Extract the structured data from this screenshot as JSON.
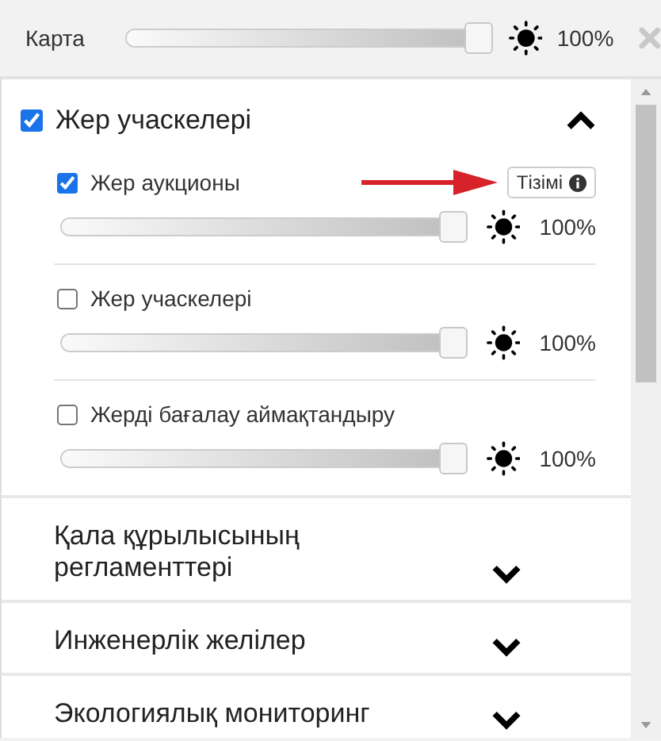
{
  "header": {
    "label": "Карта",
    "level": 1,
    "reading": "100%"
  },
  "groups": [
    {
      "title": "Жер учаскелері",
      "checked": true,
      "expanded": true,
      "layers": [
        {
          "name": "Жер аукционы",
          "checked": true,
          "list_button": "Тізімі",
          "level": 1,
          "reading": "100%"
        },
        {
          "name": "Жер учаскелері",
          "checked": false,
          "level": 1,
          "reading": "100%"
        },
        {
          "name": "Жерді бағалау аймақтандыру",
          "checked": false,
          "level": 1,
          "reading": "100%"
        }
      ]
    },
    {
      "title": "Қала құрылысының регламенттері",
      "expanded": false
    },
    {
      "title": "Инженерлік желілер",
      "expanded": false
    },
    {
      "title": "Экологиялық мониторинг",
      "expanded": false
    }
  ]
}
